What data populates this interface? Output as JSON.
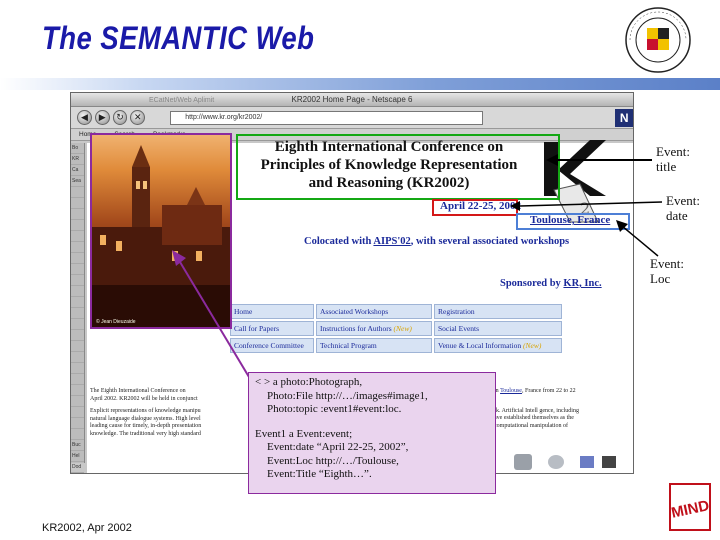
{
  "slide": {
    "title": "The SEMANTIC Web",
    "footer": "KR2002, Apr 2002"
  },
  "browser": {
    "window_title": "KR2002 Home Page - Netscape 6",
    "faded_tab": "ECatNet/Web Aplimit",
    "url": "http://www.kr.org/kr2002/",
    "bookmarks": [
      "Home",
      "Search",
      "Bookmarks"
    ],
    "side_labels": [
      "Bo",
      "KR",
      "Ca",
      "Sea",
      "",
      "",
      "",
      "",
      "",
      "",
      "",
      "",
      "",
      "",
      "",
      "",
      "",
      "",
      "",
      "",
      "",
      "",
      "",
      "",
      "",
      "",
      "",
      "Buc",
      "Hel",
      "Dod"
    ]
  },
  "page": {
    "title_lines": [
      "Eighth International Conference on",
      "Principles of Knowledge Representation",
      "and Reasoning (KR2002)"
    ],
    "date": "April 22-25, 2002",
    "location": "Toulouse, France",
    "colocated_prefix": "Colocated with ",
    "colocated_link": "AIPS'02",
    "colocated_suffix": ", with several associated workshops",
    "sponsor_prefix": "Sponsored by ",
    "sponsor_link": "KR, Inc.",
    "photo_credit": "© Jean Dieuzaide",
    "nav": [
      {
        "label": "Home",
        "new": ""
      },
      {
        "label": "Associated Workshops",
        "new": ""
      },
      {
        "label": "Registration",
        "new": ""
      },
      {
        "label": "Call for Papers",
        "new": ""
      },
      {
        "label": "Instructions for Authors ",
        "new": "(New)"
      },
      {
        "label": "Social Events",
        "new": ""
      },
      {
        "label": "Conference Committee",
        "new": ""
      },
      {
        "label": "Technical Program",
        "new": ""
      },
      {
        "label": "Venue & Local Information ",
        "new": "(New)"
      }
    ],
    "body_left": [
      "The Eighth International Conference on",
      "April 2002. KR2002 will be held in conjunct",
      "",
      "Explicit representations of knowledge manipu",
      "natural language dialogue systems. High level",
      "leading cause for timely, in-depth presentation",
      "knowledge. The traditional very high standard"
    ],
    "body_right_prefix": "in ",
    "body_right_link": "Toulouse",
    "body_right_line1_suffix": ", France from 22 to 22",
    "body_right": [
      "",
      "rk. Artificial Intell gence, including",
      "ave established themselves as the",
      "computational manipulation of"
    ]
  },
  "annotations": {
    "title": [
      "Event:",
      "title"
    ],
    "date": [
      "Event:",
      "date"
    ],
    "loc": [
      "Event:",
      "Loc"
    ]
  },
  "rdf": {
    "lines": [
      "< > a photo:Photograph,",
      "Photo:File http://…/images#image1,",
      "Photo:topic  :event1#event:loc.",
      "Event1 a Event:event;",
      "Event:date “April 22-25, 2002”,",
      "Event:Loc http://…/Toulouse,",
      "Event:Title “Eighth…”."
    ]
  },
  "logos": {
    "seal_text": "UNIVERSITY OF MARYLAND",
    "seal_bottom": "COLLEGE PARK",
    "mind": "MIND"
  }
}
